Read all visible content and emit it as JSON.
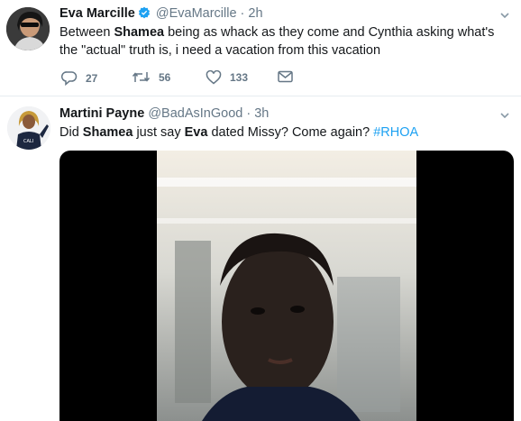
{
  "tweets": [
    {
      "author_name": "Eva Marcille",
      "author_handle": "@EvaMarcille",
      "separator": "·",
      "time": "2h",
      "verified": true,
      "text_segments": [
        {
          "text": "Between ",
          "bold": false
        },
        {
          "text": "Shamea",
          "bold": true
        },
        {
          "text": " being as whack as they come and Cynthia asking what's the \"actual\" truth is, i need a vacation from this vacation",
          "bold": false
        }
      ],
      "actions": {
        "replies": "27",
        "retweets": "56",
        "likes": "133"
      },
      "icons": [
        "reply-icon",
        "retweet-icon",
        "like-icon",
        "direct-message-icon",
        "chevron-down-icon",
        "verified-badge-icon"
      ]
    },
    {
      "author_name": "Martini Payne",
      "author_handle": "@BadAsInGood",
      "separator": "·",
      "time": "3h",
      "verified": false,
      "text_segments": [
        {
          "text": "Did ",
          "bold": false
        },
        {
          "text": "Shamea",
          "bold": true
        },
        {
          "text": " just say ",
          "bold": false
        },
        {
          "text": "Eva",
          "bold": true
        },
        {
          "text": " dated Missy? Come again? ",
          "bold": false
        },
        {
          "text": "#RHOA",
          "bold": false,
          "hashtag": true
        }
      ],
      "avatar_shirt_text": "CALI",
      "icons": [
        "chevron-down-icon",
        "video-media"
      ]
    }
  ],
  "colors": {
    "link_blue": "#1da1f2",
    "secondary_text": "#657786",
    "divider": "#e6ecf0"
  }
}
